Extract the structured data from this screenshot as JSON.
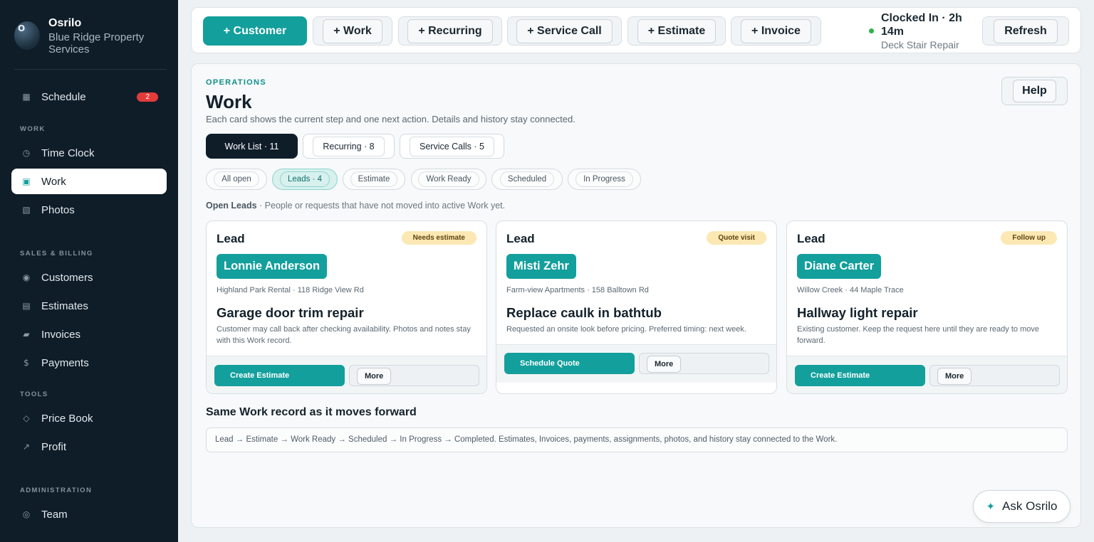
{
  "brand": {
    "name": "Osrilo",
    "company": "Blue Ridge Property Services",
    "logo_letter": "O"
  },
  "sidebar": {
    "schedule": {
      "label": "Schedule",
      "badge": "2",
      "icon": "grid-icon"
    },
    "sections": {
      "work": "WORK",
      "sales": "SALES & BILLING",
      "tools": "TOOLS",
      "admin": "ADMINISTRATION"
    },
    "items": [
      {
        "label": "Time Clock",
        "icon": "clock-icon"
      },
      {
        "label": "Work",
        "icon": "work-icon",
        "active": true
      },
      {
        "label": "Photos",
        "icon": "photo-icon"
      },
      {
        "label": "Customers",
        "icon": "customer-icon"
      },
      {
        "label": "Estimates",
        "icon": "estimate-icon"
      },
      {
        "label": "Invoices",
        "icon": "invoice-icon"
      },
      {
        "label": "Payments",
        "icon": "dollar-icon"
      },
      {
        "label": "Price Book",
        "icon": "diamond-icon"
      },
      {
        "label": "Profit",
        "icon": "arrow-up-right-icon"
      },
      {
        "label": "Team",
        "icon": "team-icon"
      }
    ]
  },
  "topbar": {
    "buttons": [
      "+ Customer",
      "+ Work",
      "+ Recurring",
      "+ Service Call",
      "+ Estimate",
      "+ Invoice"
    ],
    "clock_status": "Clocked In · 2h 14m",
    "clock_job": "Deck Stair Repair",
    "refresh_label": "Refresh",
    "accent_color": "#139f9c",
    "status_color": "#2bb34a"
  },
  "main": {
    "eyebrow": "OPERATIONS",
    "title": "Work",
    "subtitle": "Each card shows the current step and one next action. Details and history stay connected.",
    "help_label": "Help",
    "segments": [
      "Work List · 11",
      "Recurring · 8",
      "Service Calls · 5"
    ],
    "chips": [
      "All open",
      "Leads · 4",
      "Estimate",
      "Work Ready",
      "Scheduled",
      "In Progress"
    ],
    "filter_name": "Open Leads",
    "filter_desc": " · People or requests that have not moved into active Work yet.",
    "cards": [
      {
        "kind": "Lead",
        "tag": "Needs estimate",
        "name": "Lonnie Anderson",
        "location": "Highland Park Rental · 118 Ridge View Rd",
        "title": "Garage door trim repair",
        "note": "Customer may call back after checking availability. Photos and notes stay with this Work record.",
        "primary": "Create Estimate",
        "more": "More"
      },
      {
        "kind": "Lead",
        "tag": "Quote visit",
        "name": "Misti Zehr",
        "location": "Farm-view Apartments · 158 Balltown Rd",
        "title": "Replace caulk in bathtub",
        "note": "Requested an onsite look before pricing. Preferred timing: next week.",
        "primary": "Schedule Quote",
        "more": "More"
      },
      {
        "kind": "Lead",
        "tag": "Follow up",
        "name": "Diane Carter",
        "location": "Willow Creek · 44 Maple Trace",
        "title": "Hallway light repair",
        "note": "Existing customer. Keep the request here until they are ready to move forward.",
        "primary": "Create Estimate",
        "more": "More"
      }
    ],
    "section_title": "Same Work record as it moves forward",
    "flow_text": "Lead → Estimate → Work Ready → Scheduled → In Progress → Completed. Estimates, Invoices, payments, assignments, photos, and history stay connected to the Work.",
    "ask_label": "Ask Osrilo"
  }
}
